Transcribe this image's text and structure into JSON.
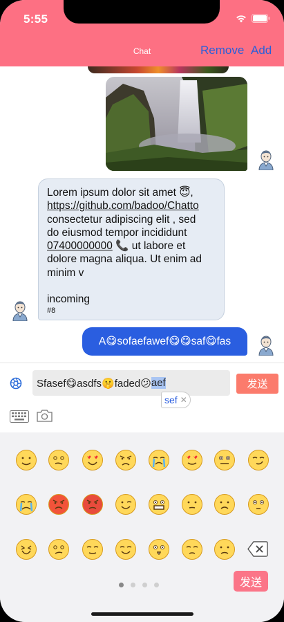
{
  "status_bar": {
    "time": "5:55"
  },
  "nav": {
    "title": "Chat",
    "remove_label": "Remove",
    "add_label": "Add"
  },
  "messages": {
    "incoming": {
      "line1": "Lorem ipsum dolor sit amet 😇,",
      "link": "https://github.com/badoo/Chatto",
      "line3": "consectetur adipiscing elit , sed",
      "line4": "do eiusmod tempor incididunt",
      "phone": "07400000000",
      "line5_rest": " 📞 ut labore et",
      "line6": "dolore magna aliqua. Ut enim ad",
      "line7": "minim v",
      "line8": "incoming",
      "number": "#8"
    },
    "outgoing": {
      "text": "A😋sofaefawef😋😋saf😋fas"
    }
  },
  "input": {
    "text_before": "Sfasef😋asdfs🤫faded😕",
    "text_highlighted": "aef",
    "suggestion": "sef",
    "send_label": "发送"
  },
  "emoji_panel": {
    "emojis": [
      "slight-smile",
      "woozy",
      "heart-eyes",
      "angry-face",
      "loudly-crying",
      "heart-eyes-2",
      "zipper-mouth",
      "smirk",
      "crying-face",
      "rage-red",
      "pouting",
      "wink-tongue",
      "grimacing",
      "thinking",
      "frowning",
      "flushed",
      "tired",
      "confused",
      "hand-over-mouth",
      "smiling",
      "astonished",
      "pensive-thinking",
      "worried"
    ],
    "page_count": 4,
    "active_page": 0,
    "send_label": "发送"
  },
  "colors": {
    "header": "#fd7083",
    "accent_blue": "#2a5ee0",
    "send_button": "#fb7b6c"
  }
}
